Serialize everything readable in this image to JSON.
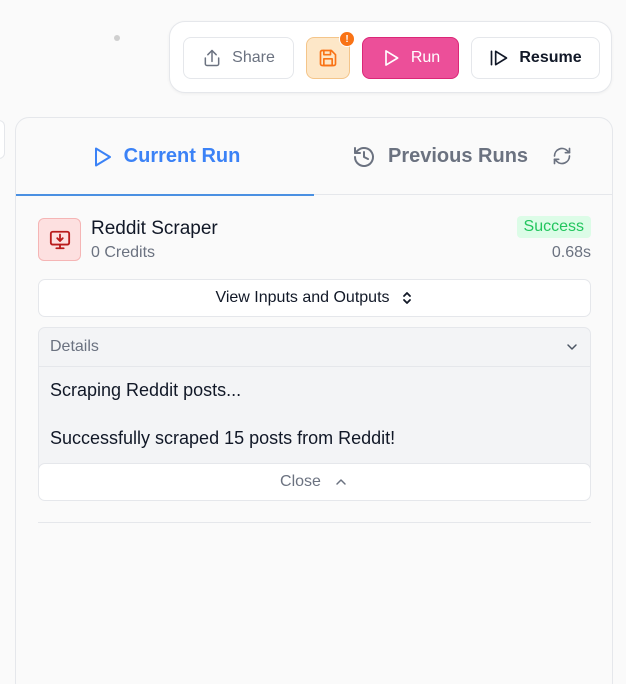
{
  "toolbar": {
    "share_label": "Share",
    "save_badge": "!",
    "run_label": "Run",
    "resume_label": "Resume"
  },
  "tabs": {
    "current_label": "Current Run",
    "previous_label": "Previous Runs"
  },
  "node": {
    "title": "Reddit Scraper",
    "credits": "0 Credits",
    "status": "Success",
    "duration": "0.68s"
  },
  "io_button_label": "View Inputs and Outputs",
  "details": {
    "header_label": "Details",
    "lines": [
      "Scraping Reddit posts...",
      "Successfully scraped 15 posts from Reddit!"
    ],
    "close_label": "Close"
  },
  "colors": {
    "accent_blue": "#3b82f6",
    "run_pink": "#ec4f99",
    "success_green": "#22c55e",
    "save_orange": "#f97316"
  },
  "icons": [
    "upload-icon",
    "save-icon",
    "play-icon",
    "resume-icon",
    "history-icon",
    "refresh-icon",
    "monitor-download-icon",
    "chevrons-up-down-icon",
    "chevron-down-icon",
    "chevron-up-icon"
  ]
}
